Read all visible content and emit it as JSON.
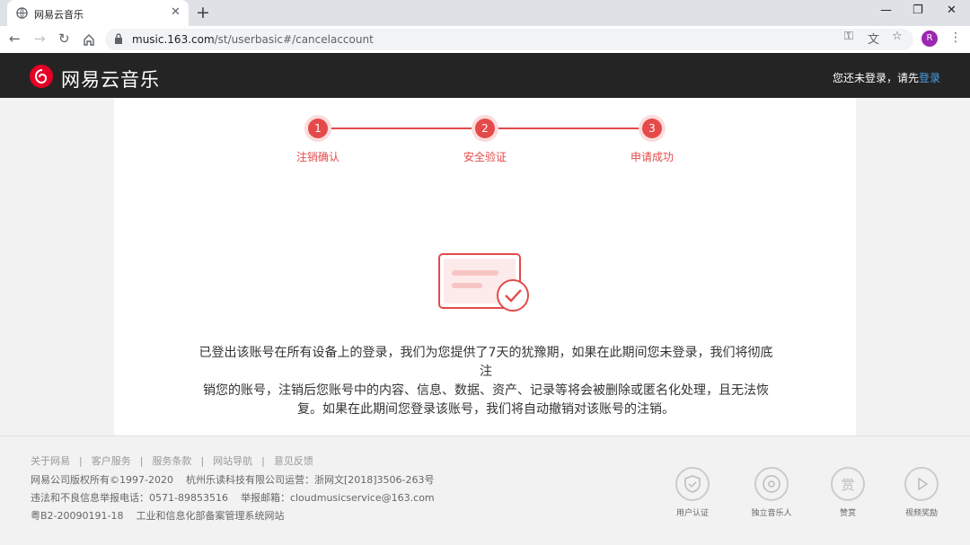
{
  "browser": {
    "tab_title": "网易云音乐",
    "url_host": "music.163.com",
    "url_path": "/st/userbasic#/cancelaccount",
    "profile_initial": "R"
  },
  "header": {
    "brand": "网易云音乐",
    "login_prompt": "您还未登录，请先",
    "login_link": "登录"
  },
  "steps": [
    {
      "number": "1",
      "label": "注销确认"
    },
    {
      "number": "2",
      "label": "安全验证"
    },
    {
      "number": "3",
      "label": "申请成功"
    }
  ],
  "notice": {
    "lines": [
      "已登出该账号在所有设备上的登录，我们为您提供了7天的犹豫期，如果在此期间您未登录，我们将彻底注",
      "销您的账号，注销后您账号中的内容、信息、数据、资产、记录等将会被删除或匿名化处理，且无法恢",
      "复。如果在此期间您登录该账号，我们将自动撤销对该账号的注销。"
    ]
  },
  "footer": {
    "links": [
      "关于网易",
      "客户服务",
      "服务条款",
      "网站导航",
      "意见反馈"
    ],
    "copyright": "网易公司版权所有©1997-2020",
    "operator": "杭州乐读科技有限公司运营：浙网文[2018]3506-263号",
    "report_phone": "违法和不良信息举报电话：0571-89853516",
    "report_email": "举报邮箱：cloudmusicservice@163.com",
    "icp": "粤B2-20090191-18",
    "icp_site": "工业和信息化部备案管理系统网站",
    "badges": [
      "用户认证",
      "独立音乐人",
      "赞赏",
      "视频奖励"
    ]
  },
  "colors": {
    "accent": "#e54a4a",
    "header_bg": "#242424",
    "link": "#4a9ee8"
  }
}
